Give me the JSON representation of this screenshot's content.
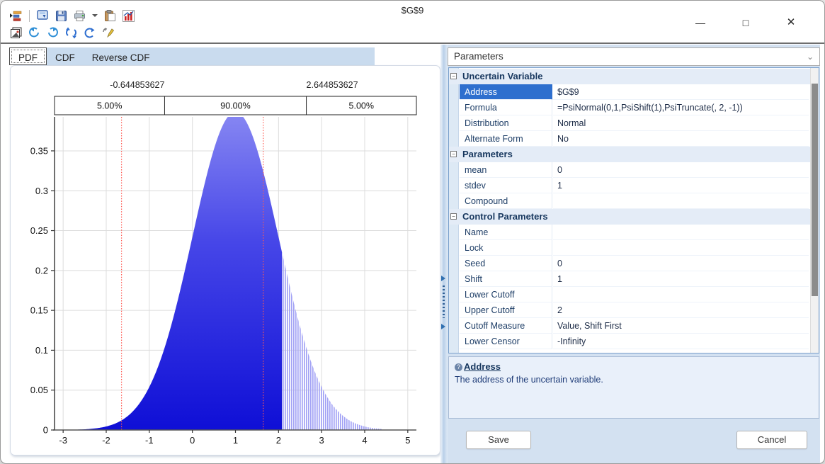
{
  "window": {
    "title": "$G$9",
    "controls": {
      "minimize": "—",
      "maximize": "□",
      "close": "✕"
    }
  },
  "toolbar": {
    "row1_icons": [
      "distribution-bars-icon",
      "copy-chart-icon",
      "save-icon",
      "print-icon",
      "dropdown-arrow-icon",
      "paste-icon",
      "chart-icon"
    ],
    "row2_icons": [
      "copy-image-icon",
      "rotate-left-icon",
      "rotate-right-icon",
      "flip-vertical-icon",
      "rotate-clockwise-icon",
      "edit-annotation-icon"
    ]
  },
  "tabs": [
    {
      "id": "pdf",
      "label": "PDF",
      "active": true
    },
    {
      "id": "cdf",
      "label": "CDF",
      "active": false
    },
    {
      "id": "reverse-cdf",
      "label": "Reverse CDF",
      "active": false
    }
  ],
  "chart_data": {
    "type": "area",
    "title": "",
    "xlabel": "",
    "ylabel": "",
    "distribution": "Normal",
    "mean": 1,
    "stdev": 1,
    "xlim": [
      -3.2,
      5.2
    ],
    "ylim": [
      0,
      0.3926
    ],
    "xticks": [
      -3,
      -2,
      -1,
      0,
      1,
      2,
      3,
      4,
      5
    ],
    "yticks": [
      0,
      0.05,
      0.1,
      0.15,
      0.2,
      0.25,
      0.3,
      0.35
    ],
    "grid": true,
    "percentile_markers": {
      "values": [
        -0.644853627,
        2.644853627
      ],
      "labels": [
        "-0.644853627",
        "2.644853627"
      ],
      "bands": [
        "5.00%",
        "90.00%",
        "5.00%"
      ]
    },
    "marker_lines": [
      -1.645,
      1.645
    ],
    "truncation": {
      "solid_until": 2.08,
      "hatched_until": 4.4
    },
    "points": {
      "x": [
        -2.5,
        -2,
        -1.5,
        -1,
        -0.5,
        0,
        0.5,
        1,
        1.5,
        2,
        2.5,
        3,
        3.5,
        4,
        4.5
      ],
      "pdf": [
        0.0009,
        0.0044,
        0.0175,
        0.054,
        0.1295,
        0.242,
        0.3521,
        0.3989,
        0.3521,
        0.242,
        0.1295,
        0.054,
        0.0175,
        0.0044,
        0.0009
      ]
    }
  },
  "parameters_panel": {
    "header": "Parameters",
    "chevron_icon": "chevron-down-icon",
    "grid_rows": [
      {
        "type": "section",
        "label": "Uncertain Variable"
      },
      {
        "type": "row",
        "name": "Address",
        "value": "$G$9",
        "selected": true
      },
      {
        "type": "row",
        "name": "Formula",
        "value": "=PsiNormal(0,1,PsiShift(1),PsiTruncate(, 2, -1))"
      },
      {
        "type": "row",
        "name": "Distribution",
        "value": "Normal"
      },
      {
        "type": "row",
        "name": "Alternate Form",
        "value": "No"
      },
      {
        "type": "section",
        "label": "Parameters"
      },
      {
        "type": "row",
        "name": "mean",
        "value": "0"
      },
      {
        "type": "row",
        "name": "stdev",
        "value": "1"
      },
      {
        "type": "row",
        "name": "Compound",
        "value": ""
      },
      {
        "type": "section",
        "label": "Control Parameters"
      },
      {
        "type": "row",
        "name": "Name",
        "value": ""
      },
      {
        "type": "row",
        "name": "Lock",
        "value": ""
      },
      {
        "type": "row",
        "name": "Seed",
        "value": "0"
      },
      {
        "type": "row",
        "name": "Shift",
        "value": "1"
      },
      {
        "type": "row",
        "name": "Lower Cutoff",
        "value": ""
      },
      {
        "type": "row",
        "name": "Upper Cutoff",
        "value": "2"
      },
      {
        "type": "row",
        "name": "Cutoff Measure",
        "value": "Value, Shift First"
      },
      {
        "type": "row",
        "name": "Lower Censor",
        "value": "-Infinity"
      }
    ],
    "description": {
      "help_icon": "help-icon",
      "title": "Address",
      "text": "The address of the uncertain variable."
    },
    "buttons": {
      "save": "Save",
      "cancel": "Cancel"
    }
  }
}
